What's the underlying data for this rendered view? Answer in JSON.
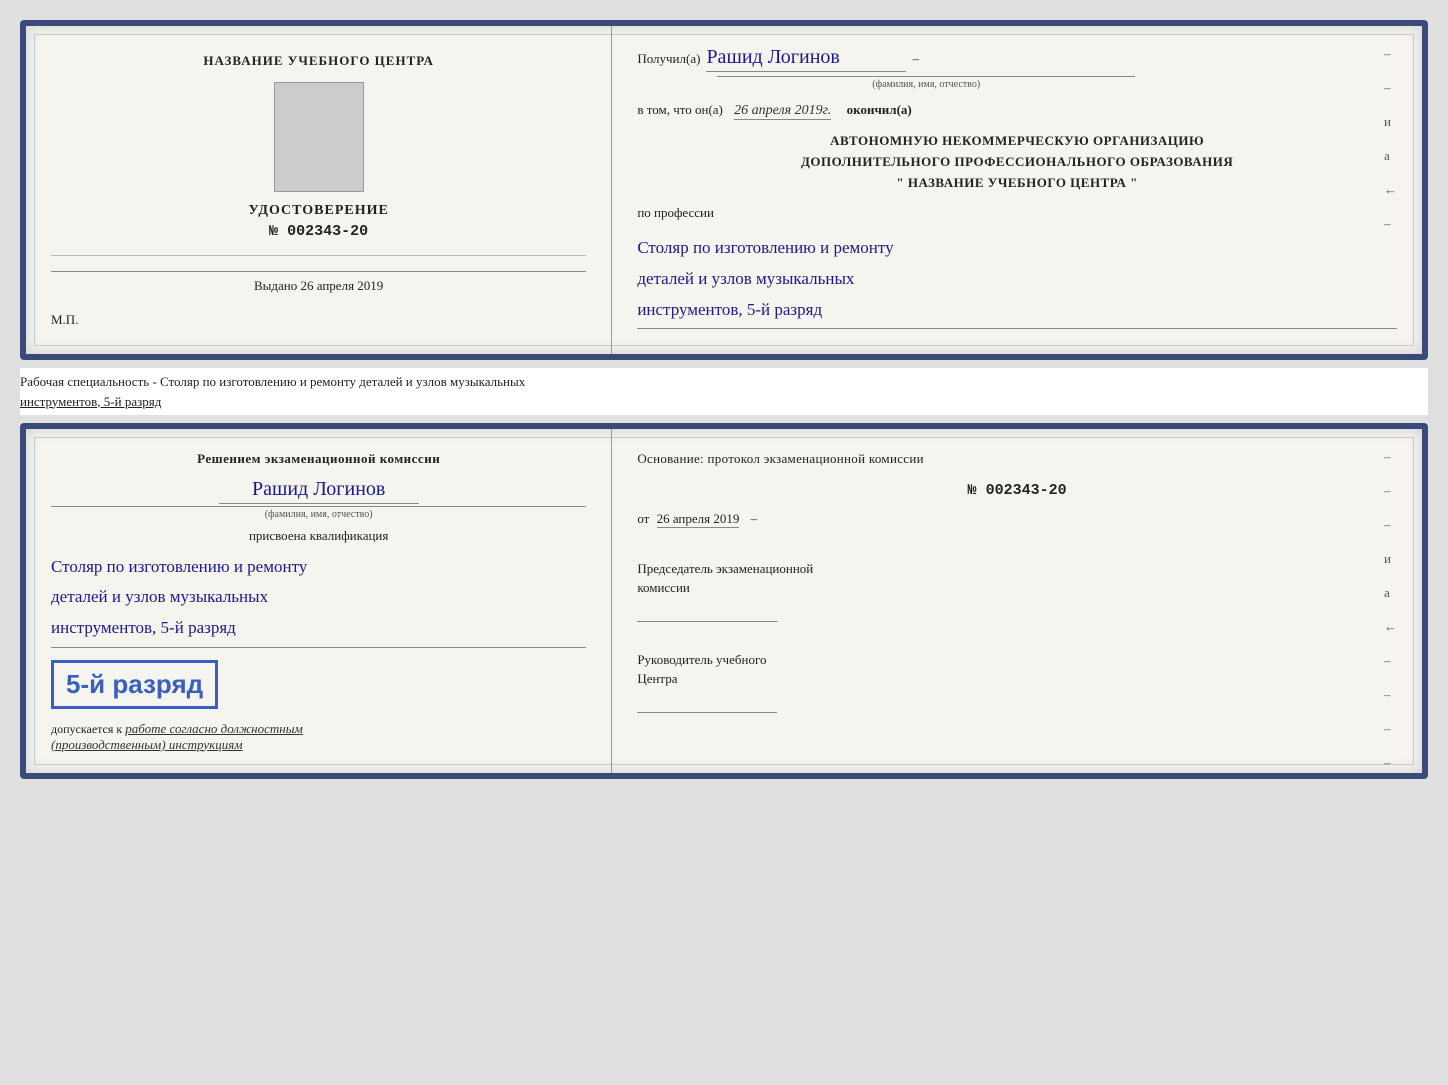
{
  "doc1": {
    "left": {
      "title": "НАЗВАНИЕ УЧЕБНОГО ЦЕНТРА",
      "photo_alt": "photo",
      "cert_title": "УДОСТОВЕРЕНИЕ",
      "cert_number": "№ 002343-20",
      "vydano_label": "Выдано",
      "vydano_date": "26 апреля 2019",
      "mp_label": "М.П."
    },
    "right": {
      "poluchil_label": "Получил(а)",
      "recipient_name": "Рашид Логинов",
      "name_subtext": "(фамилия, имя, отчество)",
      "dash": "–",
      "v_tom_label": "в том, что он(а)",
      "completion_date": "26 апреля 2019г.",
      "okончил_label": "окончил(а)",
      "org_block_line1": "АВТОНОМНУЮ НЕКОММЕРЧЕСКУЮ ОРГАНИЗАЦИЮ",
      "org_block_line2": "ДОПОЛНИТЕЛЬНОГО ПРОФЕССИОНАЛЬНОГО ОБРАЗОВАНИЯ",
      "org_block_line3": "\"  НАЗВАНИЕ УЧЕБНОГО ЦЕНТРА  \"",
      "po_professii_label": "по профессии",
      "profession_line1": "Столяр по изготовлению и ремонту",
      "profession_line2": "деталей и узлов музыкальных",
      "profession_line3": "инструментов, 5-й разряд",
      "right_edge_items": [
        "–",
        "–",
        "и",
        "а",
        "←",
        "–"
      ]
    }
  },
  "between": {
    "text": "Рабочая специальность - Столяр по изготовлению и ремонту деталей и узлов музыкальных",
    "text2": "инструментов, 5-й разряд"
  },
  "doc2": {
    "left": {
      "resheniem_line1": "Решением  экзаменационной  комиссии",
      "recipient_name": "Рашид Логинов",
      "name_subtext": "(фамилия, имя, отчество)",
      "prisvoena_label": "присвоена квалификация",
      "profession_line1": "Столяр по изготовлению и ремонту",
      "profession_line2": "деталей и узлов музыкальных",
      "profession_line3": "инструментов, 5-й разряд",
      "razryad_badge": "5-й разряд",
      "dopuskaetsya_label": "допускается к",
      "dopuskaetsya_text": "работе согласно должностным",
      "dopuskaetsya_text2": "(производственным) инструкциям"
    },
    "right": {
      "osnovanie_label": "Основание: протокол экзаменационной  комиссии",
      "protokol_number": "№  002343-20",
      "ot_label": "от",
      "ot_date": "26 апреля 2019",
      "predsedatel_label": "Председатель экзаменационной",
      "komissii_label": "комиссии",
      "rukovoditel_label": "Руководитель учебного",
      "centra_label": "Центра",
      "right_edge_items": [
        "–",
        "–",
        "–",
        "и",
        "а",
        "←",
        "–",
        "–",
        "–",
        "–"
      ]
    }
  }
}
